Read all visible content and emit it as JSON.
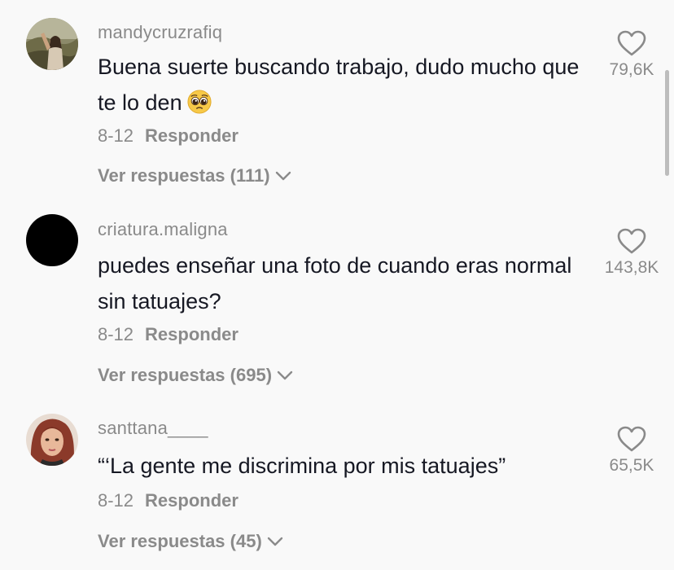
{
  "comments": [
    {
      "username": "mandycruzrafiq",
      "text": "Buena suerte buscando trabajo, dudo mucho que te lo den",
      "emoji_icon": "pleading-face-emoji",
      "date": "8-12",
      "reply_label": "Responder",
      "view_replies_label": "Ver respuestas (111)",
      "likes": "79,6K"
    },
    {
      "username": "criatura.maligna",
      "text": "puedes enseñar una foto de cuando eras normal sin tatuajes?",
      "date": "8-12",
      "reply_label": "Responder",
      "view_replies_label": "Ver respuestas (695)",
      "likes": "143,8K"
    },
    {
      "username": "santtana____",
      "text": "“‘La gente me discrimina por mis tatuajes”",
      "date": "8-12",
      "reply_label": "Responder",
      "view_replies_label": "Ver respuestas (45)",
      "likes": "65,5K"
    }
  ],
  "colors": {
    "background": "#f9f9f9",
    "text": "#161823",
    "secondary": "#8a8a8a"
  }
}
